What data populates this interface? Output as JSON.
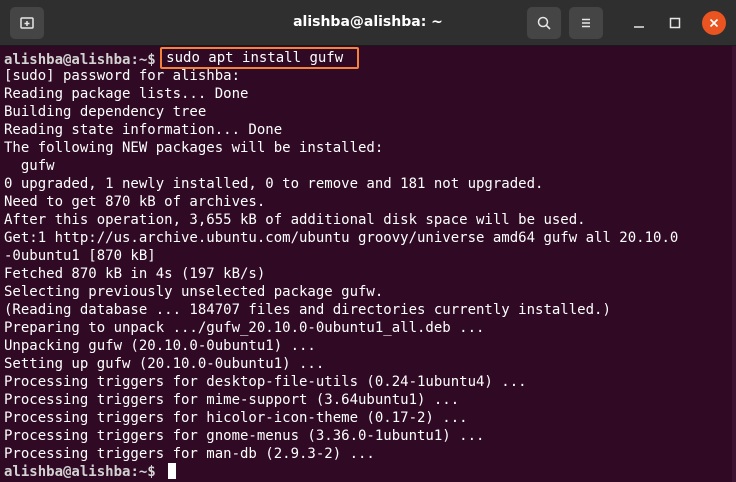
{
  "window": {
    "title": "alishba@alishba: ~",
    "icons": {
      "new_tab": "new-tab-icon",
      "search": "search-icon",
      "menu": "hamburger-menu-icon",
      "minimize": "minimize-icon",
      "maximize": "maximize-icon",
      "close": "close-icon"
    },
    "colors": {
      "titlebar": "#2f2f2f",
      "terminal_bg": "#300a24",
      "close": "#e95420",
      "highlight": "#f5823a"
    }
  },
  "terminal": {
    "first_prompt": {
      "user": "alishba@alishba",
      "path": ":~$ ",
      "command": "sudo apt install gufw"
    },
    "output": [
      "[sudo] password for alishba:",
      "Reading package lists... Done",
      "Building dependency tree",
      "Reading state information... Done",
      "The following NEW packages will be installed:",
      "  gufw",
      "0 upgraded, 1 newly installed, 0 to remove and 181 not upgraded.",
      "Need to get 870 kB of archives.",
      "After this operation, 3,655 kB of additional disk space will be used.",
      "Get:1 http://us.archive.ubuntu.com/ubuntu groovy/universe amd64 gufw all 20.10.0",
      "-0ubuntu1 [870 kB]",
      "Fetched 870 kB in 4s (197 kB/s)",
      "Selecting previously unselected package gufw.",
      "(Reading database ... 184707 files and directories currently installed.)",
      "Preparing to unpack .../gufw_20.10.0-0ubuntu1_all.deb ...",
      "Unpacking gufw (20.10.0-0ubuntu1) ...",
      "Setting up gufw (20.10.0-0ubuntu1) ...",
      "Processing triggers for desktop-file-utils (0.24-1ubuntu4) ...",
      "Processing triggers for mime-support (3.64ubuntu1) ...",
      "Processing triggers for hicolor-icon-theme (0.17-2) ...",
      "Processing triggers for gnome-menus (3.36.0-1ubuntu1) ...",
      "Processing triggers for man-db (2.9.3-2) ..."
    ],
    "last_prompt": {
      "user": "alishba@alishba",
      "path": ":~$ "
    }
  }
}
